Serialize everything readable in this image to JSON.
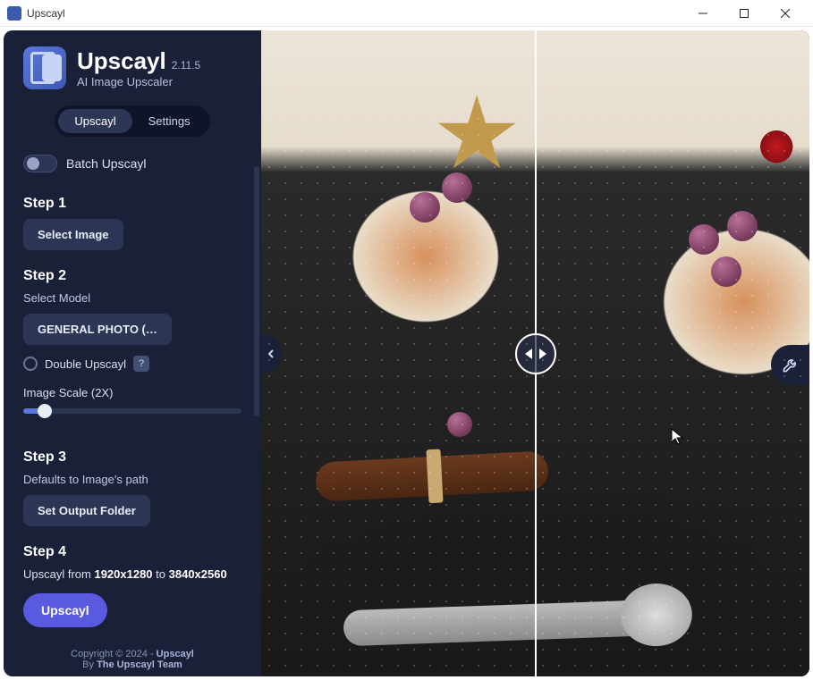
{
  "titlebar": {
    "title": "Upscayl"
  },
  "brand": {
    "name": "Upscayl",
    "version": "2.11.5",
    "subtitle": "AI Image Upscaler"
  },
  "tabs": {
    "upscayl": "Upscayl",
    "settings": "Settings"
  },
  "batch": {
    "label": "Batch Upscayl"
  },
  "step1": {
    "title": "Step 1",
    "select_image": "Select Image"
  },
  "step2": {
    "title": "Step 2",
    "select_model_label": "Select Model",
    "model": "GENERAL PHOTO (…",
    "double_upscayl": "Double Upscayl",
    "help": "?",
    "scale_label": "Image Scale (2X)"
  },
  "step3": {
    "title": "Step 3",
    "defaults": "Defaults to Image's path",
    "set_output": "Set Output Folder"
  },
  "step4": {
    "title": "Step 4",
    "prefix": "Upscayl from ",
    "from_res": "1920x1280",
    "to_word": " to ",
    "to_res": "3840x2560",
    "action": "Upscayl"
  },
  "footer": {
    "copyright": "Copyright © 2024 - ",
    "brand": "Upscayl",
    "by": "By ",
    "team": "The Upscayl Team"
  }
}
